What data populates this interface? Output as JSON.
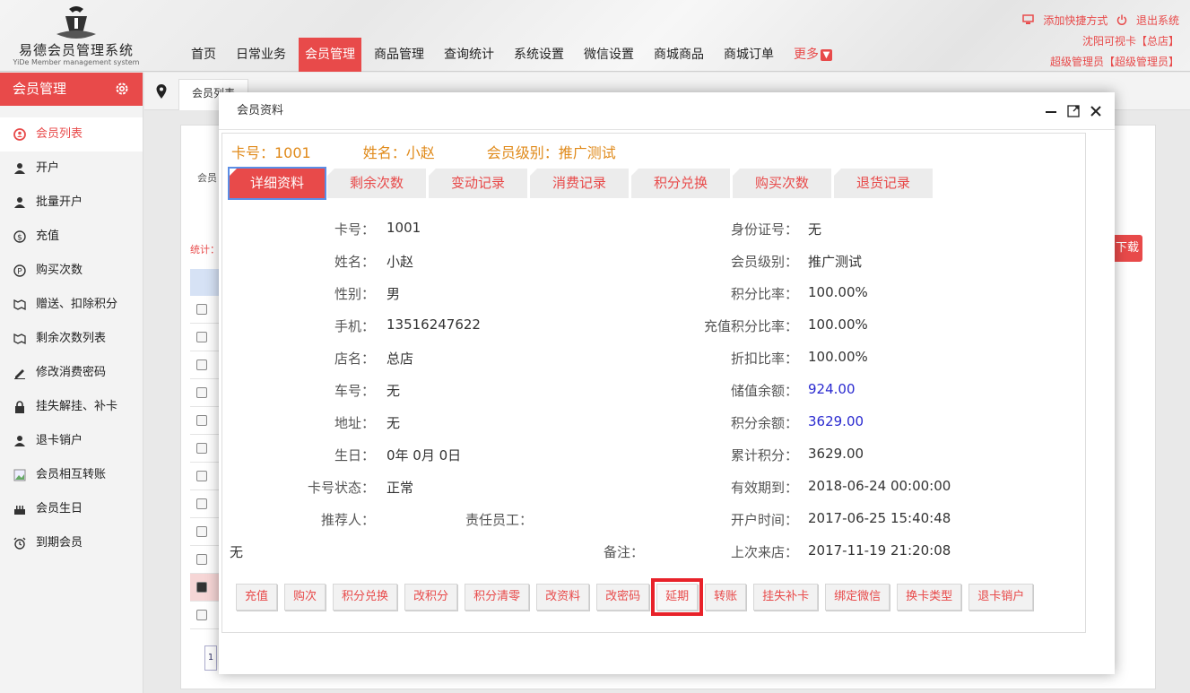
{
  "header": {
    "app_name": "易德会员管理系统",
    "app_subtitle": "YiDe Member management system",
    "nav": [
      "首页",
      "日常业务",
      "会员管理",
      "商品管理",
      "查询统计",
      "系统设置",
      "微信设置",
      "商城商品",
      "商城订单"
    ],
    "nav_more": "更多",
    "shortcut": "添加快捷方式",
    "logout": "退出系统",
    "store": "沈阳可视卡【总店】",
    "user": "超级管理员【超级管理员】",
    "accent": "#e84a4a"
  },
  "sidebar": {
    "title": "会员管理",
    "items": [
      {
        "label": "会员列表",
        "icon": "member-list-icon"
      },
      {
        "label": "开户",
        "icon": "user-icon"
      },
      {
        "label": "批量开户",
        "icon": "user-icon"
      },
      {
        "label": "充值",
        "icon": "dollar-icon"
      },
      {
        "label": "购买次数",
        "icon": "ticket-icon"
      },
      {
        "label": "赠送、扣除积分",
        "icon": "points-icon"
      },
      {
        "label": "剩余次数列表",
        "icon": "points-icon"
      },
      {
        "label": "修改消费密码",
        "icon": "edit-icon"
      },
      {
        "label": "挂失解挂、补卡",
        "icon": "lock-icon"
      },
      {
        "label": "退卡销户",
        "icon": "user-icon"
      },
      {
        "label": "会员相互转账",
        "icon": "image-icon"
      },
      {
        "label": "会员生日",
        "icon": "cake-icon"
      },
      {
        "label": "到期会员",
        "icon": "alarm-icon"
      }
    ]
  },
  "tabbar": {
    "tab": "会员列表"
  },
  "background": {
    "label": "会员",
    "stat": "统计：",
    "download": "下载",
    "page": "1"
  },
  "modal": {
    "title": "会员资料",
    "card_no": "卡号：1001",
    "name": "姓名：小赵",
    "level": "会员级别：推广测试",
    "tabs": [
      "详细资料",
      "剩余次数",
      "变动记录",
      "消费记录",
      "积分兑换",
      "购买次数",
      "退货记录"
    ],
    "left": [
      {
        "label": "卡号：",
        "value": "1001"
      },
      {
        "label": "姓名：",
        "value": "小赵"
      },
      {
        "label": "性别：",
        "value": "男"
      },
      {
        "label": "手机：",
        "value": "13516247622"
      },
      {
        "label": "店名：",
        "value": "总店"
      },
      {
        "label": "车号：",
        "value": "无"
      },
      {
        "label": "地址：",
        "value": "无"
      },
      {
        "label": "生日：",
        "value": "0年 0月 0日"
      },
      {
        "label": "卡号状态：",
        "value": "正常"
      }
    ],
    "right": [
      {
        "label": "身份证号：",
        "value": "无"
      },
      {
        "label": "会员级别：",
        "value": "推广测试"
      },
      {
        "label": "积分比率：",
        "value": "100.00%"
      },
      {
        "label": "充值积分比率：",
        "value": "100.00%"
      },
      {
        "label": "折扣比率：",
        "value": "100.00%"
      },
      {
        "label": "储值余额：",
        "value": "924.00"
      },
      {
        "label": "积分余额：",
        "value": "3629.00"
      },
      {
        "label": "累计积分：",
        "value": "3629.00"
      },
      {
        "label": "有效期到：",
        "value": "2018-06-24 00:00:00"
      },
      {
        "label": "开户时间：",
        "value": "2017-06-25 15:40:48"
      },
      {
        "label": "上次来店：",
        "value": "2017-11-19 21:20:08"
      }
    ],
    "referrer_label": "推荐人：",
    "staff_label": "责任员工：",
    "remark_label": "备注：",
    "remark_value": "无",
    "buttons": [
      "充值",
      "购次",
      "积分兑换",
      "改积分",
      "积分清零",
      "改资料",
      "改密码",
      "延期",
      "转账",
      "挂失补卡",
      "绑定微信",
      "换卡类型",
      "退卡销户"
    ]
  }
}
